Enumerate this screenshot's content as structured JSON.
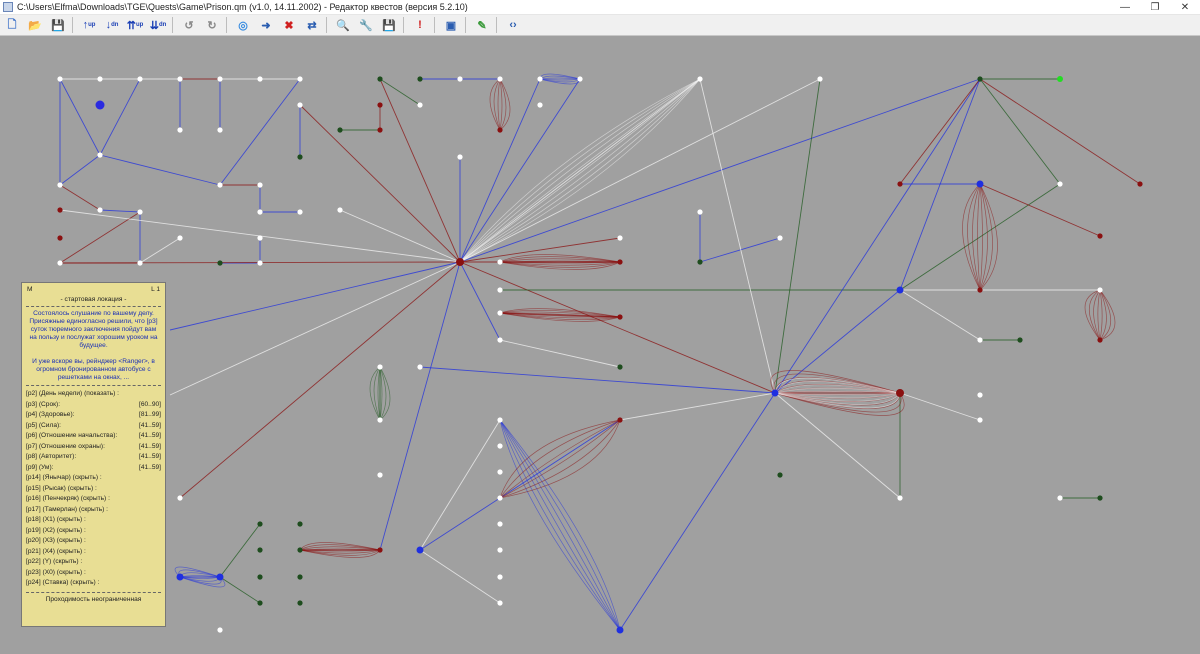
{
  "window": {
    "title": "C:\\Users\\Elfma\\Downloads\\TGE\\Quests\\Game\\Prison.qm (v1.0, 14.11.2002)  - Редактор квестов (версия 5.2.10)",
    "minimize": "—",
    "restore": "❐",
    "close": "✕"
  },
  "toolbar": [
    {
      "name": "new-file-icon",
      "glyph": "🗋",
      "color": "#3a6fc8"
    },
    {
      "name": "open-folder-icon",
      "glyph": "📂",
      "color": "#d9a520"
    },
    {
      "name": "save-icon",
      "glyph": "💾",
      "color": "#2a5db0"
    },
    {
      "sep": true
    },
    {
      "name": "move-up-icon",
      "glyph": "↑",
      "sub": "up",
      "color": "#1a3fb5"
    },
    {
      "name": "move-down-icon",
      "glyph": "↓",
      "sub": "dn",
      "color": "#1a3fb5"
    },
    {
      "name": "move-all-up-icon",
      "glyph": "⇈",
      "sub": "up",
      "color": "#1a3fb5"
    },
    {
      "name": "move-all-down-icon",
      "glyph": "⇊",
      "sub": "dn",
      "color": "#1a3fb5"
    },
    {
      "sep": true
    },
    {
      "name": "undo-icon",
      "glyph": "↺",
      "color": "#888"
    },
    {
      "name": "redo-icon",
      "glyph": "↻",
      "color": "#888"
    },
    {
      "sep": true
    },
    {
      "name": "add-location-icon",
      "glyph": "◎",
      "color": "#3a8de0"
    },
    {
      "name": "add-path-icon",
      "glyph": "➜",
      "color": "#2a5db0"
    },
    {
      "name": "delete-icon",
      "glyph": "✖",
      "color": "#d02020"
    },
    {
      "name": "link-icon",
      "glyph": "⇄",
      "color": "#2a5db0"
    },
    {
      "sep": true
    },
    {
      "name": "search-icon",
      "glyph": "🔍",
      "color": "#2a5db0"
    },
    {
      "name": "settings-icon",
      "glyph": "🔧",
      "color": "#2a5db0"
    },
    {
      "name": "save-as-icon",
      "glyph": "💾",
      "color": "#c02020"
    },
    {
      "sep": true
    },
    {
      "name": "info-icon",
      "glyph": "!",
      "color": "#d02020"
    },
    {
      "sep": true
    },
    {
      "name": "window-icon",
      "glyph": "▣",
      "color": "#2a5db0"
    },
    {
      "sep": true
    },
    {
      "name": "edit-icon",
      "glyph": "✎",
      "color": "#3a9a3a"
    },
    {
      "sep": true
    },
    {
      "name": "code-icon",
      "glyph": "‹›",
      "color": "#2a5db0"
    }
  ],
  "info_panel": {
    "left_tag": "M",
    "right_tag": "L 1",
    "location_type": "- стартовая локация -",
    "description": [
      "Состоялось слушание по вашему делу.",
      "Присяжные единогласно решили, что [p3]",
      "суток тюремного заключения пойдут вам",
      "на пользу и послужат хорошим уроком на",
      "будущее.",
      "",
      "И уже вскоре вы, рейнджер <Ranger>, в",
      "огромном бронированном автобусе с",
      "решетками на окнах, ..."
    ],
    "params": [
      {
        "label": "[p2] (День недели) (показать) :",
        "value": ""
      },
      {
        "label": "[p3] (Срок):",
        "value": "[60..90]"
      },
      {
        "label": "[p4] (Здоровье):",
        "value": "[81..99]"
      },
      {
        "label": "[p5] (Сила):",
        "value": "[41..59]"
      },
      {
        "label": "[p6] (Отношение начальства):",
        "value": "[41..59]"
      },
      {
        "label": "[p7] (Отношение охраны):",
        "value": "[41..59]"
      },
      {
        "label": "[p8] (Авторитет):",
        "value": "[41..59]"
      },
      {
        "label": "[p9] (Ум):",
        "value": "[41..59]"
      },
      {
        "label": "[p14] (Янычар) (скрыть) :",
        "value": ""
      },
      {
        "label": "[p15] (Рысак) (скрыть) :",
        "value": ""
      },
      {
        "label": "[p16] (Пенчекряк) (скрыть) :",
        "value": ""
      },
      {
        "label": "[p17] (Тамерлан) (скрыть) :",
        "value": ""
      },
      {
        "label": "[p18] (X1) (скрыть) :",
        "value": ""
      },
      {
        "label": "[p19] (X2) (скрыть) :",
        "value": ""
      },
      {
        "label": "[p20] (X3) (скрыть) :",
        "value": ""
      },
      {
        "label": "[p21] (X4) (скрыть) :",
        "value": ""
      },
      {
        "label": "[p22] (Y) (скрыть) :",
        "value": ""
      },
      {
        "label": "[p23] (X0) (скрыть) :",
        "value": ""
      },
      {
        "label": "[p24] (Ставка) (скрыть) :",
        "value": ""
      }
    ],
    "footer": "Проходимость неограниченная"
  },
  "colors": {
    "canvas_bg": "#a0a0a0",
    "edge_blue": "#1f2fe0",
    "edge_red": "#8a1010",
    "edge_green": "#1e5a1e",
    "edge_white": "#f4f4f4",
    "node_white": "#ffffff",
    "node_red": "#8a1010",
    "node_green": "#1e4d1e",
    "node_start": "#2a2ae0",
    "node_end": "#22dd22",
    "panel_bg": "#e8de94"
  }
}
